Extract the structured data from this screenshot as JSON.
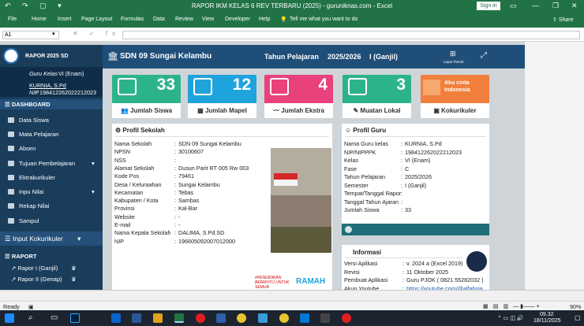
{
  "titlebar": {
    "title": "RAPOR IKM KELAS 6 REV TERBARU (2025) - guruniknas.com - Excel",
    "signin": "Sign in",
    "qat": "↶ ↷ ▢ ▾"
  },
  "ribbon": {
    "tabs": [
      "File",
      "Home",
      "Insert",
      "Page Layout",
      "Formulas",
      "Data",
      "Review",
      "View",
      "Developer",
      "Help"
    ],
    "tellme": "Tell me what you want to do",
    "share": "Share"
  },
  "formula": {
    "namebox": "A1",
    "fx": "✕ ✓ fx"
  },
  "sidebar": {
    "app": "RAPOR 2025 SD",
    "guru_label": "Guru Kelas",
    "kelas": "VI (Enam)",
    "guru_name": "KURNIA, S.Pd",
    "nip_label": "NIP",
    "nip": "198412262022212023",
    "dashboard": "DASHBOARD",
    "items": [
      {
        "label": "Data Siswa",
        "arrow": ""
      },
      {
        "label": "Mata Pelajaran",
        "arrow": ""
      },
      {
        "label": "Absen",
        "arrow": ""
      },
      {
        "label": "Tujuan Pembelajaran",
        "arrow": "▾"
      },
      {
        "label": "Ektrakurikuler",
        "arrow": ""
      },
      {
        "label": "Inpu Nilai",
        "arrow": "▾"
      },
      {
        "label": "Rekap Nilai",
        "arrow": ""
      },
      {
        "label": "Sampul",
        "arrow": ""
      }
    ],
    "kokurikuler": "Input Kokurikuler",
    "raport": "RAPORT",
    "raport_items": [
      "Rapor I (Ganjil)",
      "Rapor II (Genap)"
    ]
  },
  "header": {
    "school": "SDN 09 Sungai Kelambu",
    "tahun_label": "Tahun Pelajaran",
    "tahun": "2025/2026",
    "semester": "I (Ganjil)",
    "layar": "Layar Penuh"
  },
  "cards": [
    {
      "num": "33",
      "label": "Jumlah Siswa",
      "color": "#2db38a"
    },
    {
      "num": "12",
      "label": "Jumlah Mapel",
      "color": "#1fa3dc"
    },
    {
      "num": "4",
      "label": "Jumlah Ekstra",
      "color": "#e8417b"
    },
    {
      "num": "3",
      "label": "Muatan Lokal",
      "color": "#2db38a"
    },
    {
      "num": "",
      "label": "Kokurikuler",
      "color": "#f07f3c",
      "text": "Aku cinta Indonesia"
    }
  ],
  "profil_sekolah": {
    "title": "Profil Sekolah",
    "rows": [
      [
        "Nama Sekolah",
        "SDN 09 Sungai Kelambu"
      ],
      [
        "NPSN",
        "30100607"
      ],
      [
        "NSS",
        ""
      ],
      [
        "Alamat Sekolah",
        "Dusun Parit RT 005 Rw 003"
      ],
      [
        "Kode Pos",
        "79461"
      ],
      [
        "Desa / Keluraahan",
        "Sungai Kelambu"
      ],
      [
        "Kecamatan",
        "Tebas"
      ],
      [
        "Kabupaten / Kota",
        "Sambas"
      ],
      [
        "Provinsi",
        "Kal-Bar"
      ],
      [
        "Website",
        "-"
      ],
      [
        "E-mail",
        "-"
      ],
      [
        "Nama Kepala Sekolah",
        "DALIMA, S.Pd.SD"
      ],
      [
        "NIP",
        "196605092007012000"
      ]
    ],
    "logo1": "#PENDIDIKAN BERMUTU UNTUK SEMUA",
    "logo2": "RAMAH"
  },
  "profil_guru": {
    "title": "Profil Guru",
    "rows": [
      [
        "Nama Guru kelas",
        "KURNIA, S.Pd"
      ],
      [
        "NIP/NIPPPK",
        "198412262022212023"
      ],
      [
        "Kelas",
        "VI (Enam)"
      ],
      [
        "Fase",
        "C"
      ],
      [
        "Tahun Pelajaran",
        "2025/2026"
      ],
      [
        "Semester",
        "I (Ganjil)"
      ],
      [
        "Tempat/Tanggal Rapor",
        ""
      ],
      [
        "Tanggal Tahun Ajaran",
        ""
      ],
      [
        "Jumlah Siswa",
        "33"
      ]
    ]
  },
  "informasi": {
    "title": "Informasi",
    "rows": [
      [
        "Versi Aplikasi",
        "v. 2024 a (Excel 2019)"
      ],
      [
        "Revisi",
        "11 Oktober 2025"
      ],
      [
        "Pembuat Aplikasi",
        "Guru PJOK ( 0821 55282032 )"
      ],
      [
        "Akun Youtube",
        "https://youtube.com/@alfahsia"
      ]
    ]
  },
  "status": {
    "ready": "Ready",
    "zoom": "90%"
  },
  "taskbar": {
    "time": "09.32",
    "date": "18/11/2025"
  }
}
